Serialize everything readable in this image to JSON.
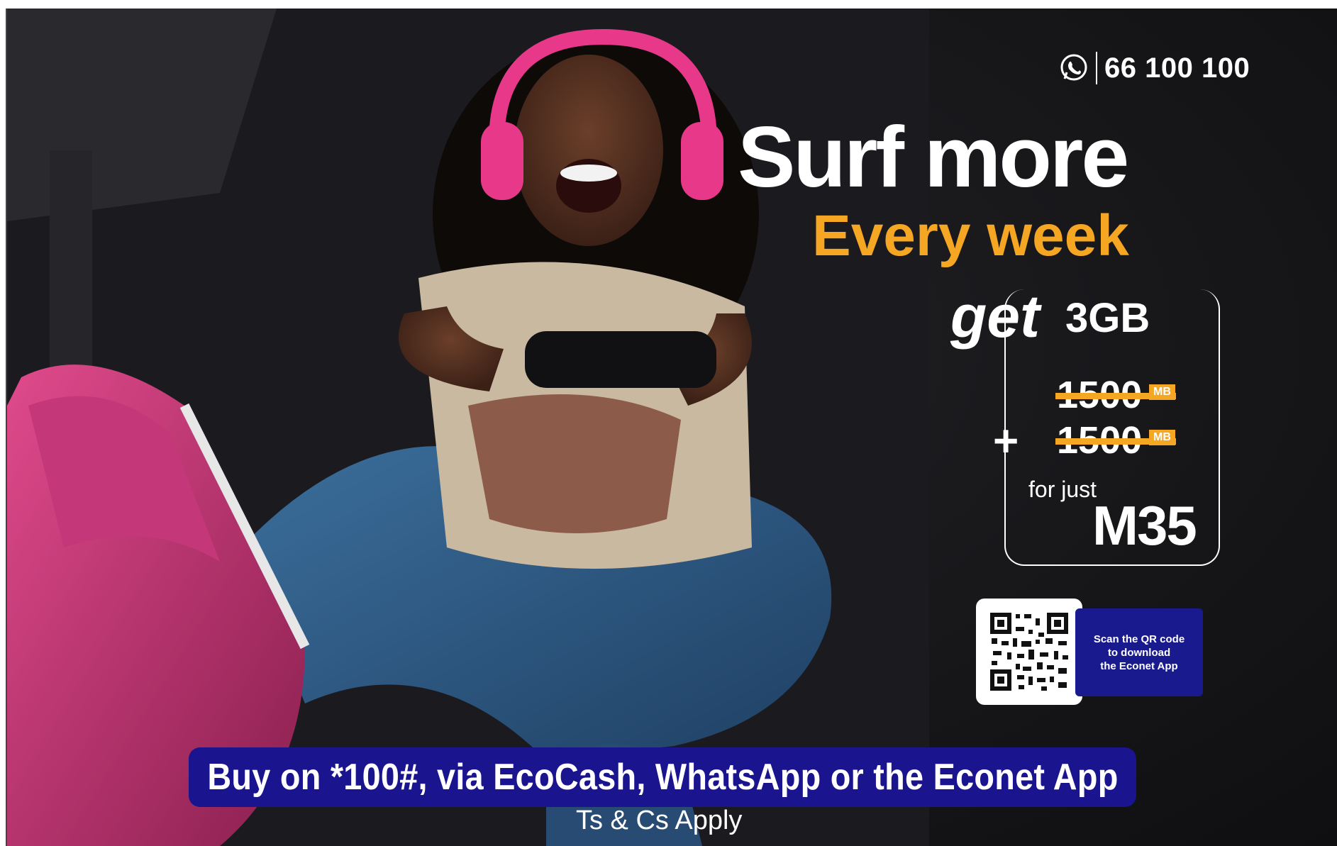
{
  "contact": {
    "icon": "whatsapp-icon",
    "number": "66 100 100"
  },
  "headline": "Surf more",
  "subhead": "Every week",
  "offer": {
    "get": "get",
    "data": "3GB",
    "bundle_1": "1500",
    "bundle_1_unit": "MB",
    "plus": "+",
    "bundle_2": "1500",
    "bundle_2_unit": "MB",
    "for_just": "for just",
    "price": "M35"
  },
  "qr": {
    "icon": "qr-code-icon",
    "line_1": "Scan the QR code",
    "line_2": "to download",
    "line_3": "the Econet App"
  },
  "cta": "Buy on *100#, via EcoCash, WhatsApp or the Econet App",
  "terms": "Ts & Cs Apply",
  "colors": {
    "accent": "#f5a623",
    "cta_bg": "#1b148f",
    "headphones": "#e8388a"
  }
}
